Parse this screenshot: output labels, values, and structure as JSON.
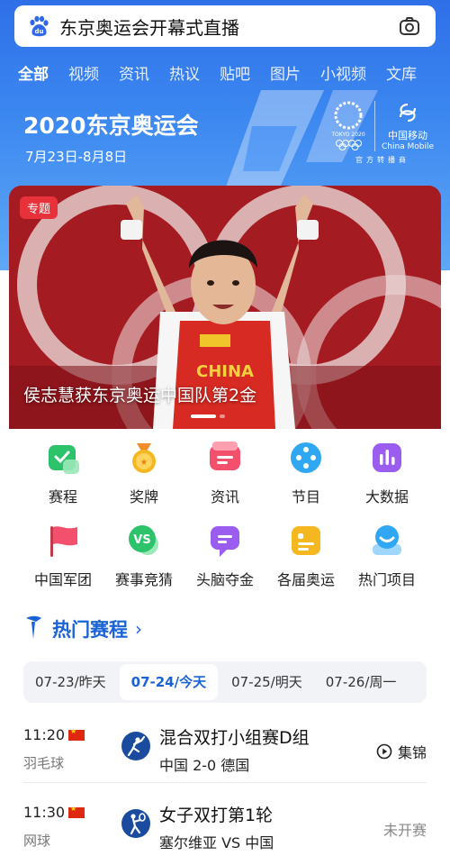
{
  "search": {
    "query": "东京奥运会开幕式直播"
  },
  "tabs": [
    "全部",
    "视频",
    "资讯",
    "热议",
    "贴吧",
    "图片",
    "小视频",
    "文库"
  ],
  "event": {
    "title": "2020东京奥运会",
    "dates": "7月23日-8月8日"
  },
  "sponsor": {
    "olympic_text": "TOKYO 2020",
    "name": "中国移动",
    "name_en": "China Mobile",
    "official": "官方转播商"
  },
  "hero": {
    "badge": "专题",
    "caption": "侯志慧获东京奥运中国队第2金",
    "jersey": "CHINA"
  },
  "grid": {
    "row1": [
      {
        "label": "赛程",
        "icon": "schedule-icon",
        "color": "#2cc36b"
      },
      {
        "label": "奖牌",
        "icon": "medal-icon",
        "color": "#f5b71f"
      },
      {
        "label": "资讯",
        "icon": "news-icon",
        "color": "#f2506d"
      },
      {
        "label": "节目",
        "icon": "program-icon",
        "color": "#2fa7f2"
      },
      {
        "label": "大数据",
        "icon": "bigdata-icon",
        "color": "#9b5cf0"
      }
    ],
    "row2": [
      {
        "label": "中国军团",
        "icon": "flag-icon",
        "color": "#f2506d"
      },
      {
        "label": "赛事竞猜",
        "icon": "vs-icon",
        "color": "#2cc36b"
      },
      {
        "label": "头脑夺金",
        "icon": "quiz-icon",
        "color": "#9b5cf0"
      },
      {
        "label": "各届奥运",
        "icon": "history-icon",
        "color": "#f5b71f"
      },
      {
        "label": "热门项目",
        "icon": "popular-sport-icon",
        "color": "#2fa7f2"
      }
    ]
  },
  "section": {
    "title": "热门赛程",
    "arrow": "›"
  },
  "dates": [
    "07-23/昨天",
    "07-24/今天",
    "07-25/明天",
    "07-26/周一"
  ],
  "matches": [
    {
      "time": "11:20",
      "sport": "羽毛球",
      "title": "混合双打小组赛D组",
      "score": "中国  2-0  德国",
      "action": "集锦",
      "icon": "badminton-icon"
    },
    {
      "time": "11:30",
      "sport": "网球",
      "title": "女子双打第1轮",
      "score": "塞尔维亚  VS  中国",
      "status": "未开赛",
      "icon": "tennis-icon"
    }
  ],
  "colors": {
    "brand_blue": "#1a63d6",
    "header_blue": "#2f6fe8",
    "hero_red": "#b01d26"
  }
}
